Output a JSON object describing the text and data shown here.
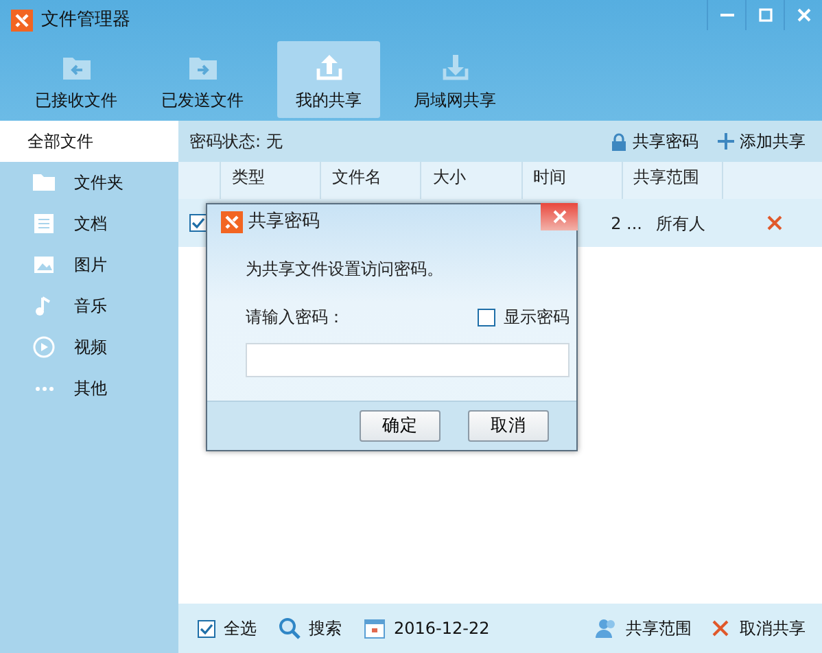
{
  "window": {
    "title": "文件管理器"
  },
  "toolbar": [
    {
      "label": "已接收文件",
      "kind": "received",
      "selected": false
    },
    {
      "label": "已发送文件",
      "kind": "sent",
      "selected": false
    },
    {
      "label": "我的共享",
      "kind": "upload",
      "selected": true
    },
    {
      "label": "局域网共享",
      "kind": "download",
      "selected": false
    }
  ],
  "sidebar": {
    "items": [
      {
        "label": "全部文件",
        "kind": "all",
        "selected": true
      },
      {
        "label": "文件夹",
        "kind": "folder",
        "selected": false
      },
      {
        "label": "文档",
        "kind": "doc",
        "selected": false
      },
      {
        "label": "图片",
        "kind": "image",
        "selected": false
      },
      {
        "label": "音乐",
        "kind": "music",
        "selected": false
      },
      {
        "label": "视频",
        "kind": "video",
        "selected": false
      },
      {
        "label": "其他",
        "kind": "other",
        "selected": false
      }
    ]
  },
  "header": {
    "status": "密码状态: 无",
    "actions": [
      {
        "label": "共享密码",
        "kind": "lock"
      },
      {
        "label": "添加共享",
        "kind": "add"
      }
    ]
  },
  "table": {
    "columns": [
      "类型",
      "文件名",
      "大小",
      "时间",
      "共享范围"
    ],
    "rows": [
      {
        "checked": true,
        "time": "2 ...",
        "scope": "所有人"
      }
    ]
  },
  "dialog": {
    "title": "共享密码",
    "message": "为共享文件设置访问密码。",
    "label": "请输入密码：",
    "show_password": {
      "label": "显示密码",
      "checked": false
    },
    "buttons": [
      "确定",
      "取消"
    ]
  },
  "status_bar": {
    "select_all": {
      "label": "全选",
      "checked": true
    },
    "search": "搜索",
    "date": "2016-12-22",
    "actions": [
      {
        "label": "共享范围",
        "kind": "people"
      },
      {
        "label": "取消共享",
        "kind": "cancel"
      }
    ]
  }
}
